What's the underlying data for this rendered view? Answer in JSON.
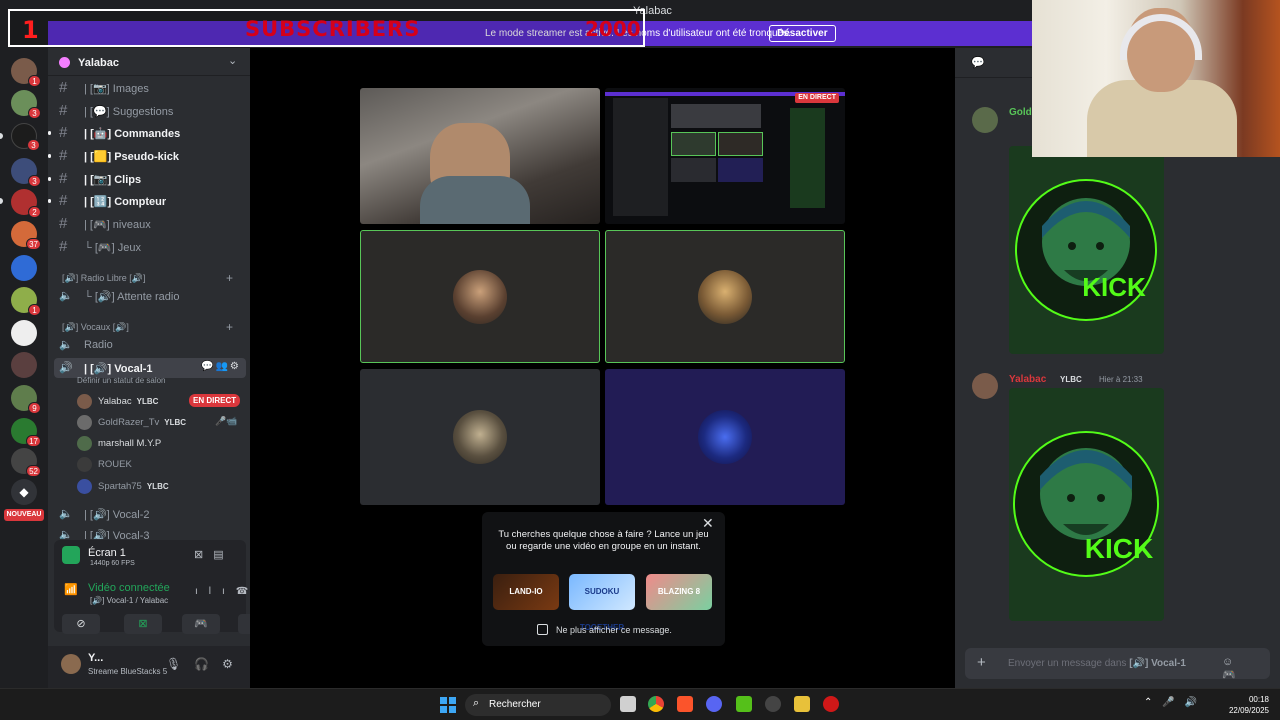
{
  "window": {
    "title": "Yalabac"
  },
  "overlay": {
    "count": "1",
    "title": "SUBSCRIBERS",
    "goal": "2000"
  },
  "streamer_banner": {
    "message": "Le mode streamer est activé. Les noms d'utilisateur ont été tronqués.",
    "button": "Désactiver"
  },
  "rail": {
    "badges": [
      "1",
      "3",
      "3",
      "3",
      "2",
      "1",
      "37",
      "1",
      "9",
      "17",
      "52"
    ],
    "new_label": "NOUVEAU"
  },
  "server": {
    "name": "Yalabac"
  },
  "channels": [
    {
      "label": "| [📷] Images",
      "bold": false
    },
    {
      "label": "| [💬] Suggestions",
      "bold": false
    },
    {
      "label": "| [🤖] Commandes",
      "bold": true
    },
    {
      "label": "| [🟨] Pseudo-kick",
      "bold": true
    },
    {
      "label": "| [📷] Clips",
      "bold": true
    },
    {
      "label": "| [🔢] Compteur",
      "bold": true
    },
    {
      "label": "| [🎮] niveaux",
      "bold": false
    },
    {
      "label": "└ [🎮] Jeux",
      "bold": false
    }
  ],
  "categories": {
    "radio": "[🔊] Radio Libre [🔊]",
    "vocaux": "[🔊] Vocaux [🔊]"
  },
  "voice_channels": {
    "attente": "└ [🔊] Attente radio",
    "radio": "Radio",
    "vocal1": "| [🔊] Vocal-1",
    "vocal2": "| [🔊] Vocal-2",
    "vocal3": "| [🔊] Vocal-3",
    "status_prompt": "Définir un statut de salon"
  },
  "voice_users": [
    {
      "name": "Yalabac",
      "tag": "YLBC",
      "live": "EN DIRECT",
      "bright": true
    },
    {
      "name": "GoldRazer_Tv",
      "tag": "YLBC",
      "live": "",
      "bright": false
    },
    {
      "name": "marshall M.Y.P",
      "tag": "",
      "live": "",
      "bright": true
    },
    {
      "name": "ROUEK",
      "tag": "",
      "live": "",
      "bright": false
    },
    {
      "name": "Spartah75",
      "tag": "YLBC",
      "live": "",
      "bright": false
    }
  ],
  "voice_panel": {
    "screen_title": "Écran 1",
    "screen_quality": "1440p 60 FPS",
    "connected": "Vidéo connectée",
    "connected_channel": "[🔊] Vocal-1 / Yalabac"
  },
  "user_panel": {
    "name": "Y...",
    "status": "Streame BlueStacks 5"
  },
  "stage": {
    "live_label": "EN DIRECT"
  },
  "activity": {
    "message": "Tu cherches quelque chose à faire ? Lance un jeu ou regarde une vidéo en groupe en un instant.",
    "games": [
      "LAND-IO",
      "SUDOKU TOGETHER",
      "BLAZING 8"
    ],
    "dont_show": "Ne plus afficher ce message."
  },
  "chat": {
    "messages": [
      {
        "author": "Gold",
        "time": ""
      },
      {
        "author": "Yalabac",
        "tag": "YLBC",
        "time": "Hier à 21:33"
      }
    ],
    "embed_text": [
      "KICK",
      "KICK"
    ],
    "input_placeholder": "Envoyer un message dans",
    "input_channel": "[🔊] Vocal-1"
  },
  "taskbar": {
    "search_placeholder": "Rechercher",
    "time": "00:18",
    "date": "22/09/2025"
  },
  "colors": {
    "accent": "#5865f2",
    "live": "#da373c",
    "online": "#23a55a",
    "banner": "#5c2fd1",
    "kick_green": "#53fc18"
  }
}
